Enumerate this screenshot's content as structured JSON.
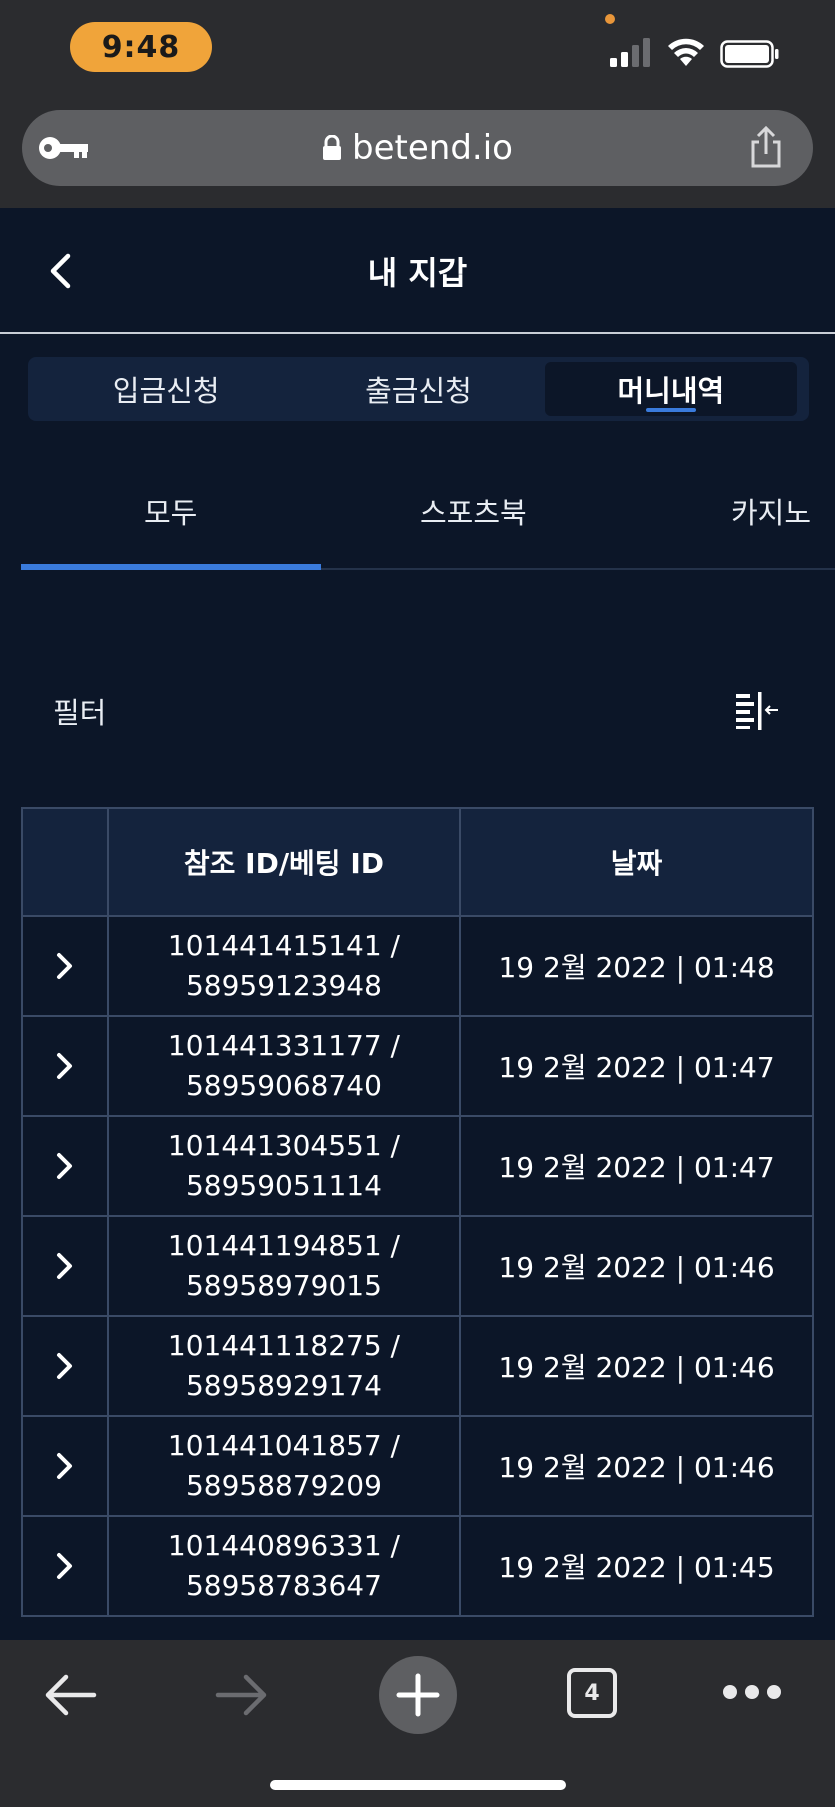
{
  "status_bar": {
    "time": "9:48"
  },
  "browser": {
    "url": "betend.io"
  },
  "header": {
    "title": "내 지갑"
  },
  "wallet_tabs": [
    {
      "label": "입금신청",
      "active": false
    },
    {
      "label": "출금신청",
      "active": false
    },
    {
      "label": "머니내역",
      "active": true
    }
  ],
  "category_tabs": [
    {
      "label": "모두",
      "active": true
    },
    {
      "label": "스포츠북",
      "active": false
    },
    {
      "label": "카지노",
      "active": false
    }
  ],
  "filter": {
    "label": "필터"
  },
  "table": {
    "headers": [
      "",
      "참조 ID/베팅 ID",
      "날짜"
    ],
    "rows": [
      {
        "ref_id": "101441415141 /",
        "bet_id": "58959123948",
        "date": "19 2월 2022 | 01:48"
      },
      {
        "ref_id": "101441331177 /",
        "bet_id": "58959068740",
        "date": "19 2월 2022 | 01:47"
      },
      {
        "ref_id": "101441304551 /",
        "bet_id": "58959051114",
        "date": "19 2월 2022 | 01:47"
      },
      {
        "ref_id": "101441194851 /",
        "bet_id": "58958979015",
        "date": "19 2월 2022 | 01:46"
      },
      {
        "ref_id": "101441118275 /",
        "bet_id": "58958929174",
        "date": "19 2월 2022 | 01:46"
      },
      {
        "ref_id": "101441041857 /",
        "bet_id": "58958879209",
        "date": "19 2월 2022 | 01:46"
      },
      {
        "ref_id": "101440896331 /",
        "bet_id": "58958783647",
        "date": "19 2월 2022 | 01:45"
      }
    ]
  },
  "toolbar": {
    "tab_count": "4"
  },
  "colors": {
    "background": "#0c1628",
    "accent": "#3a7bdc",
    "time_pill": "#f0a43a",
    "chrome": "#2b2c2f"
  }
}
